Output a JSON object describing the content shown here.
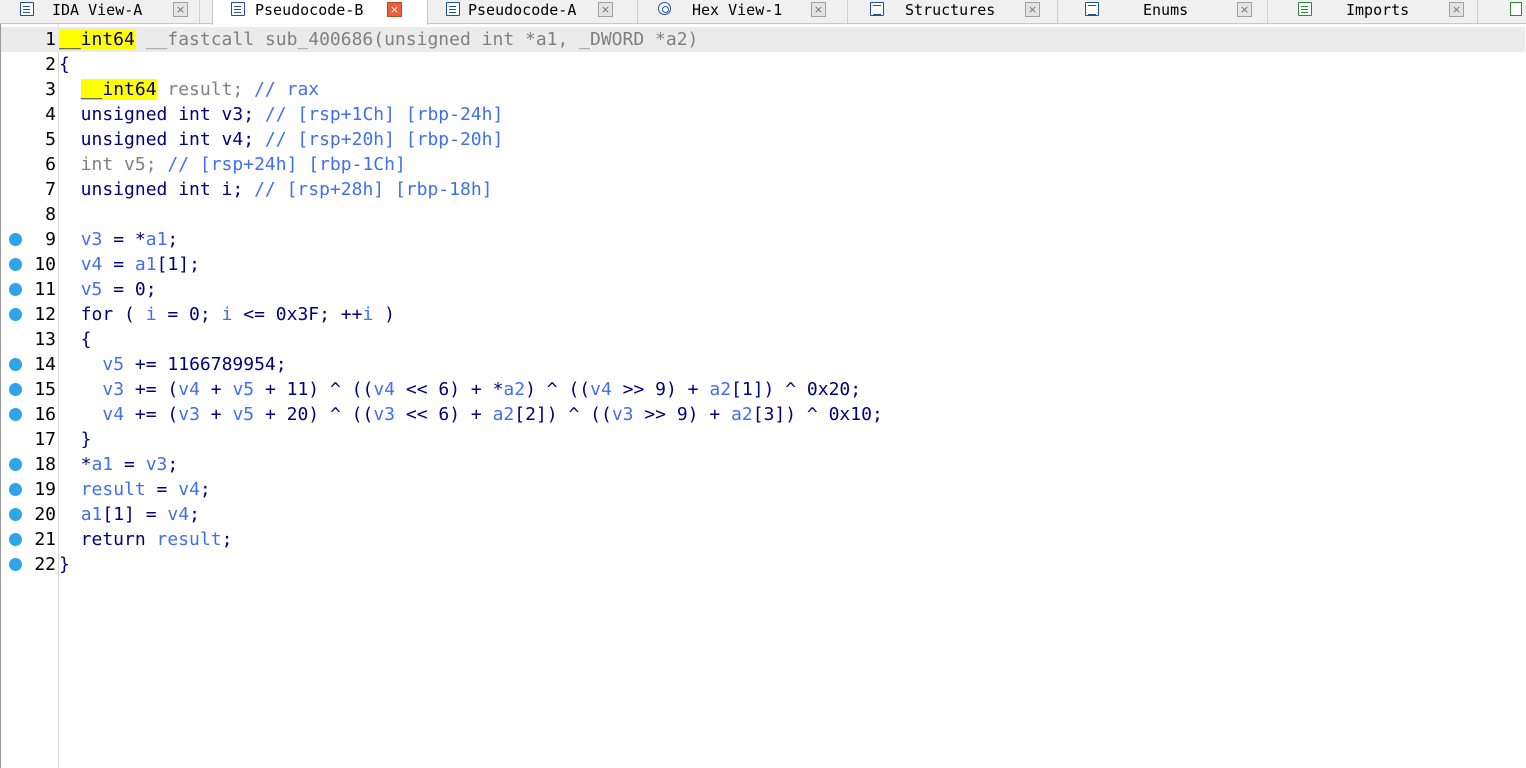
{
  "tabs": [
    {
      "label": "IDA View-A",
      "icon": "list-icon",
      "active": false
    },
    {
      "label": "Pseudocode-B",
      "icon": "list-icon",
      "active": true
    },
    {
      "label": "Pseudocode-A",
      "icon": "list-icon",
      "active": false
    },
    {
      "label": "Hex View-1",
      "icon": "hex-icon",
      "active": false
    },
    {
      "label": "Structures",
      "icon": "struct-icon",
      "active": false
    },
    {
      "label": "Enums",
      "icon": "enum-icon",
      "active": false
    },
    {
      "label": "Imports",
      "icon": "imports-icon",
      "active": false
    }
  ],
  "close_glyph": "×",
  "colors": {
    "keyword": "#000080",
    "variable": "#4070f0",
    "highlight": "#ffff00",
    "breakpoint": "#2fa4e7",
    "active_close": "#e8603c"
  },
  "code": {
    "lines": [
      {
        "n": "1",
        "bp": false,
        "parts": [
          [
            "hl",
            "__int64"
          ],
          [
            "gr",
            " __fastcall sub_400686(unsigned int *a1, _DWORD *a2)"
          ]
        ]
      },
      {
        "n": "2",
        "bp": false,
        "parts": [
          [
            "",
            "{"
          ]
        ]
      },
      {
        "n": "3",
        "bp": false,
        "parts": [
          [
            "",
            "  "
          ],
          [
            "hl",
            "__int64"
          ],
          [
            "gr",
            " result; "
          ],
          [
            "cm",
            "// rax"
          ]
        ]
      },
      {
        "n": "4",
        "bp": false,
        "parts": [
          [
            "",
            "  unsigned int v3; "
          ],
          [
            "cm",
            "// [rsp+1Ch] [rbp-24h]"
          ]
        ]
      },
      {
        "n": "5",
        "bp": false,
        "parts": [
          [
            "",
            "  unsigned int v4; "
          ],
          [
            "cm",
            "// [rsp+20h] [rbp-20h]"
          ]
        ]
      },
      {
        "n": "6",
        "bp": false,
        "parts": [
          [
            "gr",
            "  int v5; "
          ],
          [
            "cm",
            "// [rsp+24h] [rbp-1Ch]"
          ]
        ]
      },
      {
        "n": "7",
        "bp": false,
        "parts": [
          [
            "",
            "  unsigned int i; "
          ],
          [
            "cm",
            "// [rsp+28h] [rbp-18h]"
          ]
        ]
      },
      {
        "n": "8",
        "bp": false,
        "parts": [
          [
            "",
            ""
          ]
        ]
      },
      {
        "n": "9",
        "bp": true,
        "parts": [
          [
            "",
            "  "
          ],
          [
            "vr",
            "v3"
          ],
          [
            "",
            " = *"
          ],
          [
            "vr",
            "a1"
          ],
          [
            "",
            ";"
          ]
        ]
      },
      {
        "n": "10",
        "bp": true,
        "parts": [
          [
            "",
            "  "
          ],
          [
            "vr",
            "v4"
          ],
          [
            "",
            " = "
          ],
          [
            "vr",
            "a1"
          ],
          [
            "",
            "[1];"
          ]
        ]
      },
      {
        "n": "11",
        "bp": true,
        "parts": [
          [
            "",
            "  "
          ],
          [
            "vr",
            "v5"
          ],
          [
            "",
            " = 0;"
          ]
        ]
      },
      {
        "n": "12",
        "bp": true,
        "parts": [
          [
            "",
            "  for ( "
          ],
          [
            "vr",
            "i"
          ],
          [
            "",
            " = 0; "
          ],
          [
            "vr",
            "i"
          ],
          [
            "",
            " <= 0x3F; ++"
          ],
          [
            "vr",
            "i"
          ],
          [
            "",
            " )"
          ]
        ]
      },
      {
        "n": "13",
        "bp": false,
        "parts": [
          [
            "",
            "  {"
          ]
        ]
      },
      {
        "n": "14",
        "bp": true,
        "parts": [
          [
            "",
            "    "
          ],
          [
            "vr",
            "v5"
          ],
          [
            "",
            " += 1166789954;"
          ]
        ]
      },
      {
        "n": "15",
        "bp": true,
        "parts": [
          [
            "",
            "    "
          ],
          [
            "vr",
            "v3"
          ],
          [
            "",
            " += ("
          ],
          [
            "vr",
            "v4"
          ],
          [
            "",
            " + "
          ],
          [
            "vr",
            "v5"
          ],
          [
            "",
            " + 11) ^ (("
          ],
          [
            "vr",
            "v4"
          ],
          [
            "",
            " << 6) + *"
          ],
          [
            "vr",
            "a2"
          ],
          [
            "",
            ") ^ (("
          ],
          [
            "vr",
            "v4"
          ],
          [
            "",
            " >> 9) + "
          ],
          [
            "vr",
            "a2"
          ],
          [
            "",
            "[1]) ^ 0x20;"
          ]
        ]
      },
      {
        "n": "16",
        "bp": true,
        "parts": [
          [
            "",
            "    "
          ],
          [
            "vr",
            "v4"
          ],
          [
            "",
            " += ("
          ],
          [
            "vr",
            "v3"
          ],
          [
            "",
            " + "
          ],
          [
            "vr",
            "v5"
          ],
          [
            "",
            " + 20) ^ (("
          ],
          [
            "vr",
            "v3"
          ],
          [
            "",
            " << 6) + "
          ],
          [
            "vr",
            "a2"
          ],
          [
            "",
            "[2]) ^ (("
          ],
          [
            "vr",
            "v3"
          ],
          [
            "",
            " >> 9) + "
          ],
          [
            "vr",
            "a2"
          ],
          [
            "",
            "[3]) ^ 0x10;"
          ]
        ]
      },
      {
        "n": "17",
        "bp": false,
        "parts": [
          [
            "",
            "  }"
          ]
        ]
      },
      {
        "n": "18",
        "bp": true,
        "parts": [
          [
            "",
            "  *"
          ],
          [
            "vr",
            "a1"
          ],
          [
            "",
            " = "
          ],
          [
            "vr",
            "v3"
          ],
          [
            "",
            ";"
          ]
        ]
      },
      {
        "n": "19",
        "bp": true,
        "parts": [
          [
            "",
            "  "
          ],
          [
            "vr",
            "result"
          ],
          [
            "",
            " = "
          ],
          [
            "vr",
            "v4"
          ],
          [
            "",
            ";"
          ]
        ]
      },
      {
        "n": "20",
        "bp": true,
        "parts": [
          [
            "",
            "  "
          ],
          [
            "vr",
            "a1"
          ],
          [
            "",
            "[1] = "
          ],
          [
            "vr",
            "v4"
          ],
          [
            "",
            ";"
          ]
        ]
      },
      {
        "n": "21",
        "bp": true,
        "parts": [
          [
            "",
            "  return "
          ],
          [
            "vr",
            "result"
          ],
          [
            "",
            ";"
          ]
        ]
      },
      {
        "n": "22",
        "bp": true,
        "parts": [
          [
            "",
            "}"
          ]
        ]
      }
    ]
  }
}
